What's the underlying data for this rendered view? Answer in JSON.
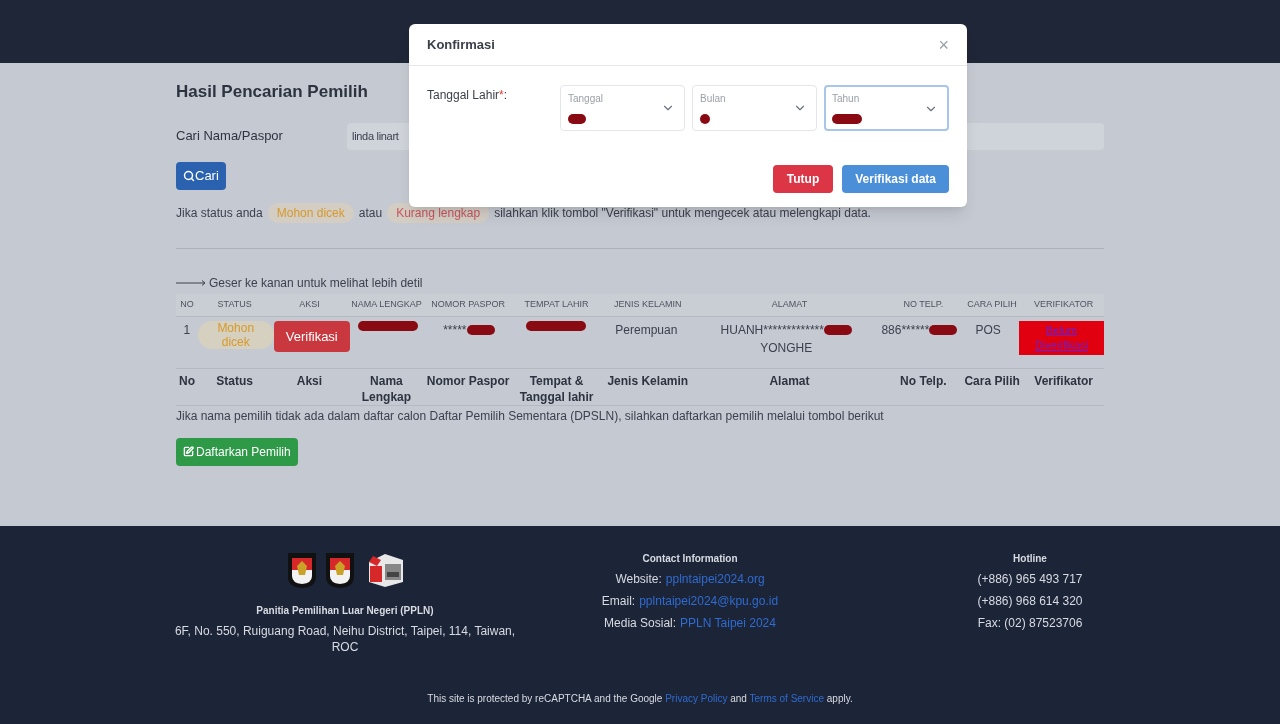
{
  "page": {
    "title": "Hasil Pencarian Pemilih",
    "search": {
      "label": "Cari Nama/Paspor",
      "value": "linda linart",
      "button": "Cari"
    },
    "info": [
      {
        "kind": "text",
        "text": "Jika status anda"
      },
      {
        "kind": "badge",
        "text": "Mohon dicek",
        "color": "#d79a2b"
      },
      {
        "kind": "text",
        "text": "atau"
      },
      {
        "kind": "badge",
        "text": "Kurang lengkap",
        "color": "#c8555e"
      },
      {
        "kind": "text",
        "text": "silahkan klik tombol \"Verifikasi\" untuk mengecek atau melengkapi data."
      }
    ],
    "scroll_hint": "Geser ke kanan untuk melihat lebih detil",
    "table": {
      "columns": [
        "NO",
        "STATUS",
        "AKSI",
        "NAMA LENGKAP",
        "NOMOR PASPOR",
        "TEMPAT LAHIR",
        "JENIS KELAMIN",
        "ALAMAT",
        "NO TELP.",
        "CARA PILIH",
        "VERIFIKATOR"
      ],
      "rows": [
        [
          {
            "kind": "text",
            "text": "1"
          },
          {
            "kind": "badge",
            "text": "Mohon dicek",
            "color": "#d79a2b"
          },
          {
            "kind": "button",
            "text": "Verifikasi"
          },
          {
            "kind": "text",
            "redacted": true
          },
          {
            "kind": "text",
            "text": "*****",
            "redacted": true
          },
          {
            "kind": "text",
            "redacted": true
          },
          {
            "kind": "text",
            "text": "Perempuan"
          },
          {
            "kind": "text",
            "text": "HUANH*************",
            "redacted": true,
            "after": "YONGHE"
          },
          {
            "kind": "text",
            "text": "886******",
            "redacted": true
          },
          {
            "kind": "text",
            "text": "POS"
          },
          {
            "kind": "flag",
            "text": "Belum Diverifikasi",
            "color": "#e00010"
          }
        ]
      ],
      "footer_columns": [
        "No",
        "Status",
        "Aksi",
        "Nama Lengkap",
        "Nomor Paspor",
        "Tempat & Tanggal lahir",
        "Jenis Kelamin",
        "Alamat",
        "No Telp.",
        "Cara Pilih",
        "Verifikator"
      ]
    },
    "register_note": "Jika nama pemilih tidak ada dalam daftar calon Daftar Pemilih Sementara (DPSLN), silahkan daftarkan pemilih melalui tombol berikut",
    "register_button": "Daftarkan Pemilih"
  },
  "modal": {
    "title": "Konfirmasi",
    "close": "×",
    "field": {
      "label": "Tanggal Lahir",
      "required_mark": "*",
      "colon": ":"
    },
    "selects": [
      {
        "label": "Tanggal",
        "redacted": true,
        "focused": false
      },
      {
        "label": "Bulan",
        "redacted": true,
        "focused": false
      },
      {
        "label": "Tahun",
        "redacted": true,
        "focused": true
      }
    ],
    "buttons": [
      {
        "kind": "danger",
        "label": "Tutup"
      },
      {
        "kind": "primary",
        "label": "Verifikasi data"
      }
    ]
  },
  "footer": {
    "org": "Panitia Pemilihan Luar Negeri (PPLN)",
    "address": "6F, No. 550, Ruiguang Road, Neihu District, Taipei, 114, Taiwan, ROC",
    "contact_title": "Contact Information",
    "contacts": [
      {
        "label": "Website:",
        "link": "pplntaipei2024.org"
      },
      {
        "label": "Email:",
        "link": "pplntaipei2024@kpu.go.id"
      },
      {
        "label": "Media Sosial:",
        "link": "PPLN Taipei 2024"
      }
    ],
    "hotline_title": "Hotline",
    "hotlines": [
      "(+886) 965 493 717",
      "(+886) 968 614 320",
      "Fax: (02) 87523706"
    ],
    "recaptcha": [
      {
        "kind": "text",
        "text": "This site is protected by reCAPTCHA and the Google"
      },
      {
        "kind": "link",
        "text": "Privacy Policy"
      },
      {
        "kind": "text",
        "text": "and"
      },
      {
        "kind": "link",
        "text": "Terms of Service"
      },
      {
        "kind": "text",
        "text": "apply."
      }
    ]
  }
}
